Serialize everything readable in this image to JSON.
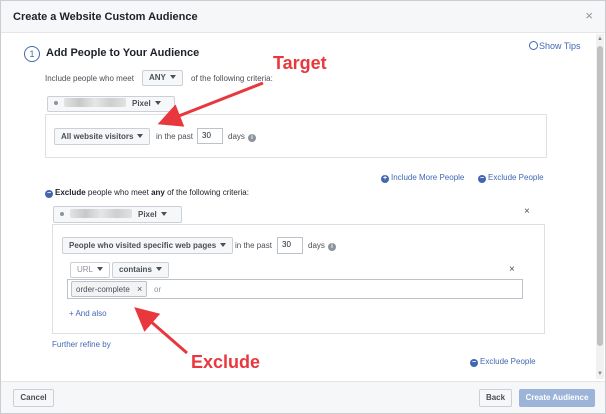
{
  "header": {
    "title": "Create a Website Custom Audience",
    "close": "×"
  },
  "step": {
    "number": "1",
    "title": "Add People to Your Audience",
    "show_tips": "Show Tips"
  },
  "include": {
    "prefix": "Include people who meet",
    "match": "ANY",
    "suffix": "of the following criteria:",
    "pixel_label": "Pixel",
    "rule": "All website visitors",
    "in_the_past": "in the past",
    "days_value": "30",
    "days": "days",
    "info": "i"
  },
  "actions": {
    "include_more": "Include More People",
    "exclude": "Exclude People",
    "plus": "+",
    "minus": "−"
  },
  "exclude": {
    "lead": "Exclude",
    "mid": "people who meet",
    "any": "any",
    "tail": "of the following criteria:",
    "pixel_label": "Pixel",
    "close": "×",
    "rule": "People who visited specific web pages",
    "in_the_past": "in the past",
    "days_value": "30",
    "days": "days",
    "info": "i",
    "url_label": "URL",
    "operator": "contains",
    "filter_close": "×",
    "token": "order-complete",
    "token_remove": "×",
    "or_placeholder": "or",
    "and_also": "+ And also",
    "further_refine": "Further refine by",
    "exclude_people": "Exclude People"
  },
  "annotations": {
    "target": "Target",
    "exclude": "Exclude",
    "color": "#e8383d"
  },
  "footer": {
    "cancel": "Cancel",
    "back": "Back",
    "create": "Create Audience"
  },
  "colors": {
    "accent": "#4267b2",
    "primary_disabled": "#9cb4d8"
  }
}
